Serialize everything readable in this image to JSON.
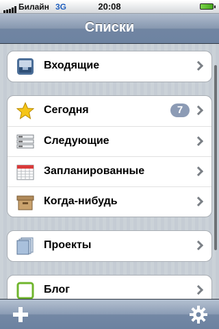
{
  "status_bar": {
    "carrier": "Билайн",
    "network": "3G",
    "time": "20:08"
  },
  "nav": {
    "title": "Списки"
  },
  "groups": [
    {
      "rows": [
        {
          "label": "Входящие",
          "icon": "inbox-icon"
        }
      ]
    },
    {
      "rows": [
        {
          "label": "Сегодня",
          "icon": "star-icon",
          "badge": "7"
        },
        {
          "label": "Следующие",
          "icon": "stack-icon"
        },
        {
          "label": "Запланированные",
          "icon": "calendar-icon"
        },
        {
          "label": "Когда-нибудь",
          "icon": "box-icon"
        }
      ]
    },
    {
      "rows": [
        {
          "label": "Проекты",
          "icon": "projects-icon"
        }
      ]
    },
    {
      "rows": [
        {
          "label": "Блог",
          "icon": "green-square-icon"
        }
      ]
    }
  ],
  "toolbar": {
    "add_icon": "plus-icon",
    "settings_icon": "gear-icon"
  },
  "colors": {
    "nav_bar": "#7a8fab",
    "badge": "#8c9bb5",
    "background": "#c5ccd4"
  }
}
